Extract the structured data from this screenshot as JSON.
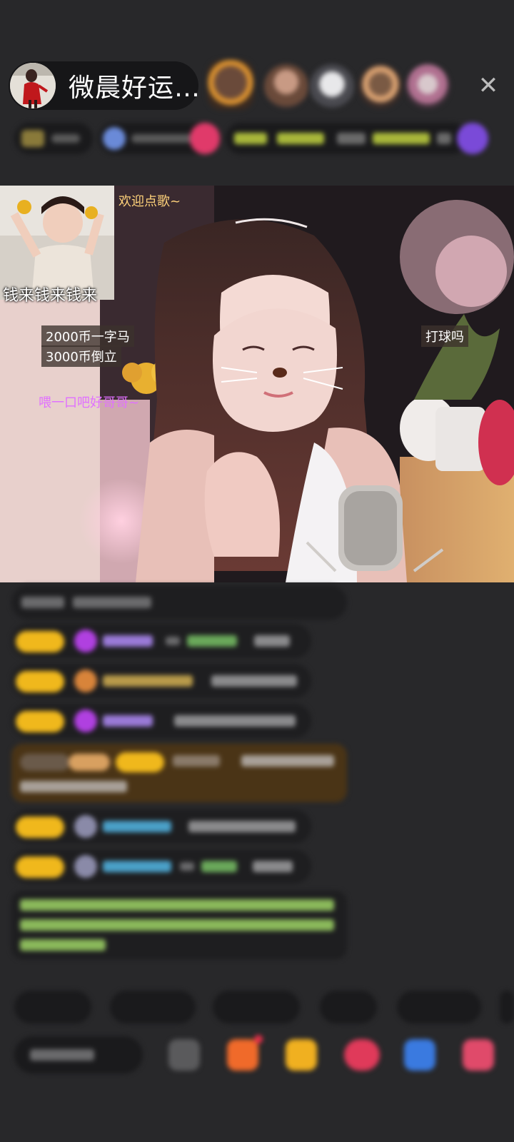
{
  "host": {
    "name": "微晨好运…"
  },
  "header": {
    "close_label": "✕"
  },
  "stream_overlay": {
    "sticker_caption": "钱来钱来钱来",
    "welcome": "欢迎点歌~",
    "price_line1": "2000币一字马",
    "price_line2": "3000币倒立",
    "feed_me": "喂一口吧好哥哥~",
    "play_ball": "打球吗"
  },
  "colors": {
    "background": "#28282a",
    "badge_gold": "#f0b81c",
    "welcome_text": "#ffd27a",
    "feed_text": "#e070ff",
    "green_notice": "#9ad25a"
  }
}
